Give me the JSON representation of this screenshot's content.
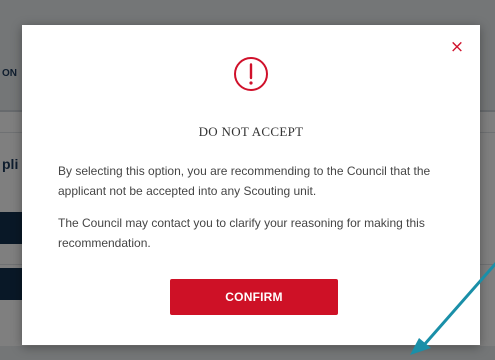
{
  "background": {
    "label_one": "ON",
    "label_two": "pli"
  },
  "modal": {
    "close_icon": "close-icon",
    "close_glyph": "×",
    "alert_icon": "exclamation-circle-icon",
    "title": "DO NOT ACCEPT",
    "paragraph_1": "By selecting this option, you are recommending to the Council that the applicant not be accepted into any Scouting unit.",
    "paragraph_2": "The Council may contact you to clarify your reasoning for making this recommendation.",
    "confirm_label": "CONFIRM"
  },
  "colors": {
    "accent_red": "#ce1126",
    "annotation_teal": "#1a8fa8",
    "navy": "#13314f"
  }
}
